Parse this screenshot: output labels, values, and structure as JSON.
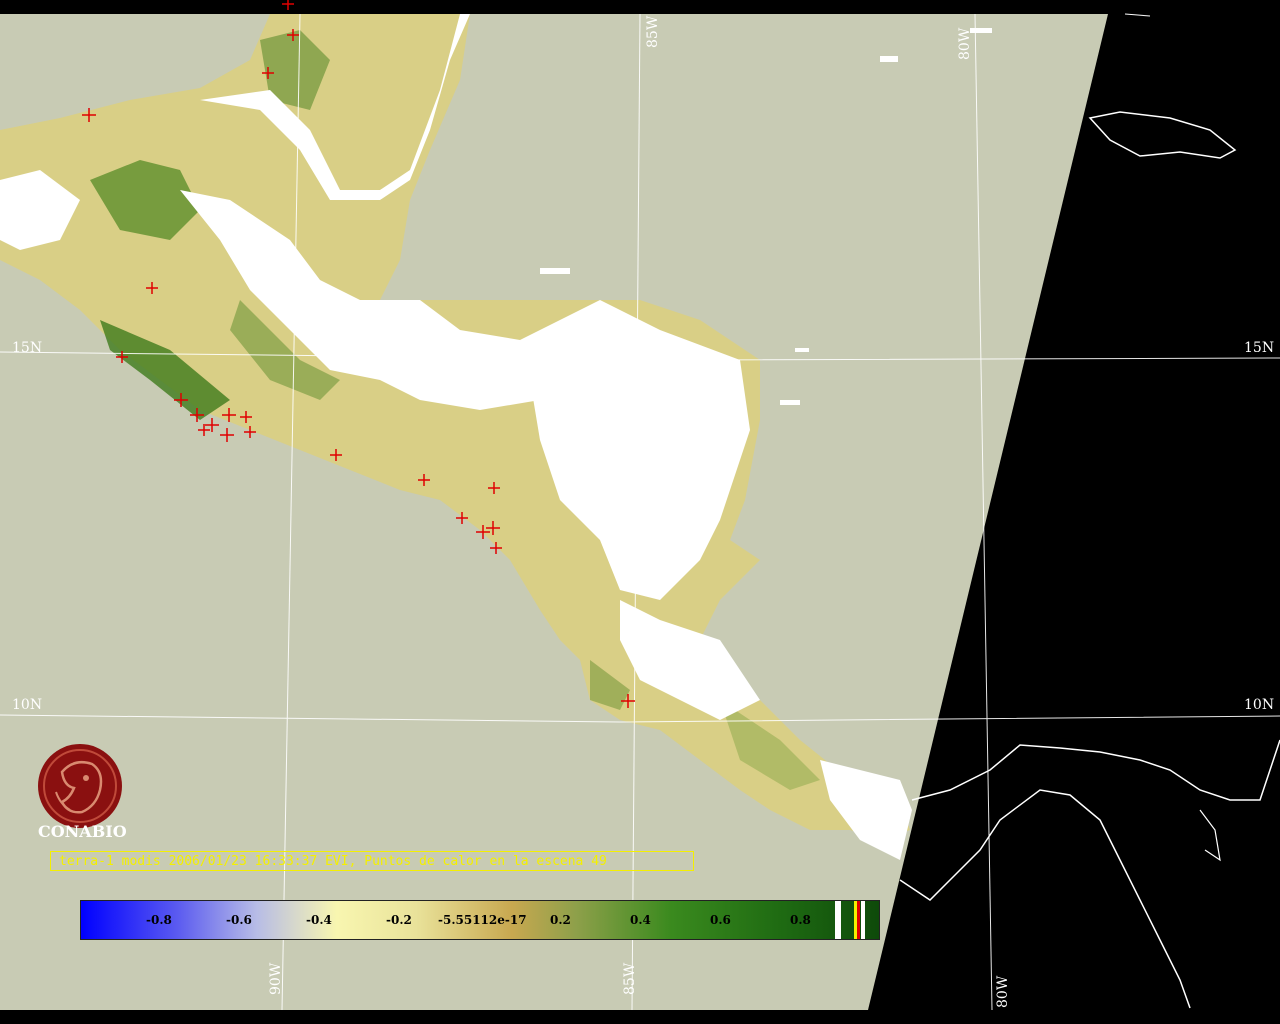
{
  "labels": {
    "lat_15_left": "15N",
    "lat_15_right": "15N",
    "lat_10_left": "10N",
    "lat_10_right": "10N",
    "lon_85_top": "85W",
    "lon_80_top": "80W",
    "lon_90_bottom": "90W",
    "lon_85_bottom": "85W",
    "lon_80_bottom": "80W"
  },
  "logo_text": "CONABIO",
  "caption": "terra-1 modis 2006/01/23 16:33:37 EVI, Puntos de calor en la escena 49",
  "colorbar": {
    "ticks": [
      "-0.8",
      "-0.6",
      "-0.4",
      "-0.2",
      "-5.55112e-17",
      "0.2",
      "0.4",
      "0.6",
      "0.8"
    ]
  },
  "colors": {
    "background": "#000000",
    "ocean": "#c8cbb4",
    "cloud": "#ffffff",
    "vegetation_low": "#d8c878",
    "vegetation_high": "#2a7a18",
    "hotspot": "#e00000",
    "caption": "#f4f000"
  },
  "icons": [
    "conabio-logo-icon",
    "hotspot-cross-icon"
  ]
}
